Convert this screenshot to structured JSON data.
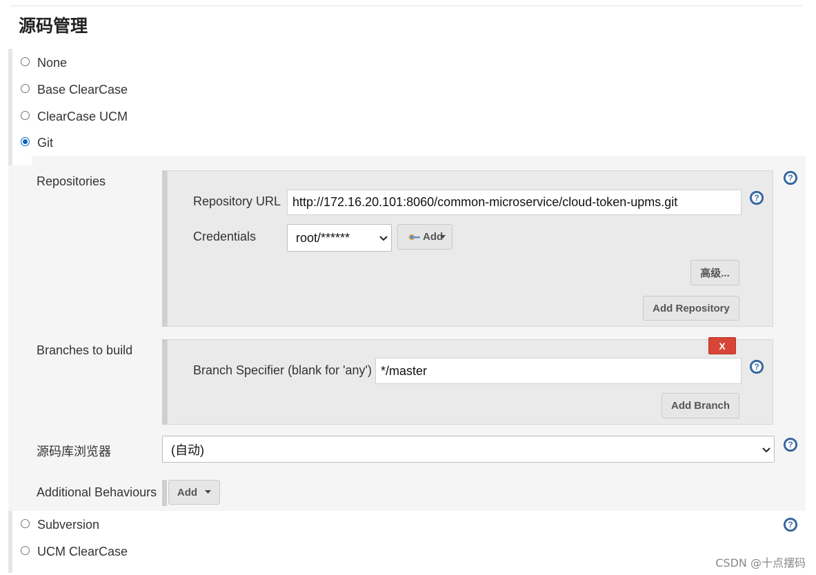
{
  "section": {
    "title": "源码管理"
  },
  "scm_options": [
    {
      "label": "None",
      "checked": false
    },
    {
      "label": "Base ClearCase",
      "checked": false
    },
    {
      "label": "ClearCase UCM",
      "checked": false
    },
    {
      "label": "Git",
      "checked": true
    },
    {
      "label": "Subversion",
      "checked": false
    },
    {
      "label": "UCM ClearCase",
      "checked": false
    }
  ],
  "git": {
    "repositories": {
      "label": "Repositories",
      "url_label": "Repository URL",
      "url_value": "http://172.16.20.101:8060/common-microservice/cloud-token-upms.git",
      "credentials_label": "Credentials",
      "credentials_value": "root/******",
      "add_credentials_label": "Add",
      "advanced_label": "高级...",
      "add_repository_label": "Add Repository"
    },
    "branches": {
      "label": "Branches to build",
      "delete_label": "X",
      "specifier_label": "Branch Specifier (blank for 'any')",
      "specifier_value": "*/master",
      "add_branch_label": "Add Branch"
    },
    "browser": {
      "label": "源码库浏览器",
      "value": "(自动)"
    },
    "behaviours": {
      "label": "Additional Behaviours",
      "add_label": "Add"
    }
  },
  "help_icon_text": "?",
  "watermark": "CSDN @十点摆码",
  "colors": {
    "help_blue": "#3d6ea8",
    "delete_red": "#d64535",
    "radio_checked": "#0a66c2"
  }
}
